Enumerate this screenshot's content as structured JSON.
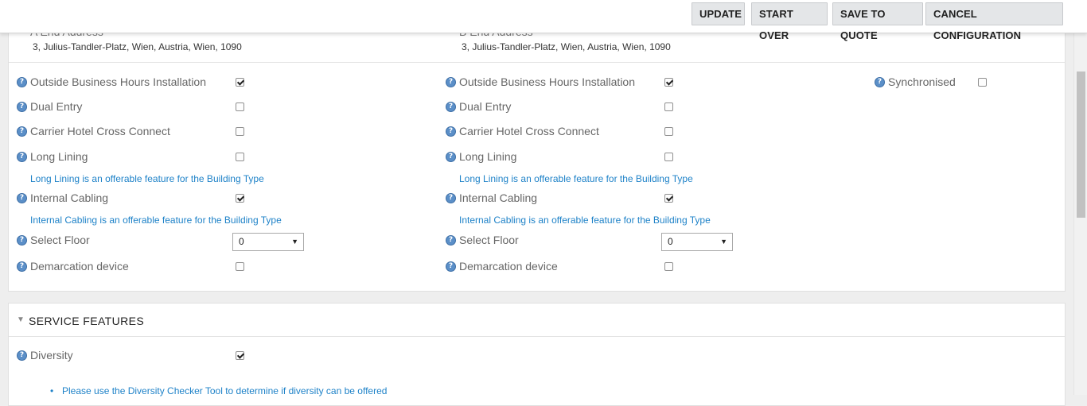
{
  "toolbar": {
    "update": "UPDATE",
    "start_over": "START OVER",
    "save_to_quote": "SAVE TO QUOTE",
    "cancel_configuration": "CANCEL CONFIGURATION"
  },
  "address": {
    "a_label": "A End Address",
    "a_value": "3, Julius-Tandler-Platz, Wien, Austria, Wien, 1090",
    "b_label": "B End Address",
    "b_value": "3, Julius-Tandler-Platz, Wien, Austria, Wien, 1090"
  },
  "features": {
    "a_end": [
      {
        "label": "Outside Business Hours Installation",
        "checked": true
      },
      {
        "label": "Dual Entry",
        "checked": false
      },
      {
        "label": "Carrier Hotel Cross Connect",
        "checked": false
      },
      {
        "label": "Long Lining",
        "checked": false,
        "note": "Long Lining is an offerable feature for the Building Type"
      },
      {
        "label": "Internal Cabling",
        "checked": true,
        "note": "Internal Cabling is an offerable feature for the Building Type"
      },
      {
        "label": "Select Floor",
        "select_value": "0"
      },
      {
        "label": "Demarcation device",
        "checked": false
      }
    ],
    "b_end": [
      {
        "label": "Outside Business Hours Installation",
        "checked": true
      },
      {
        "label": "Dual Entry",
        "checked": false
      },
      {
        "label": "Carrier Hotel Cross Connect",
        "checked": false
      },
      {
        "label": "Long Lining",
        "checked": false,
        "note": "Long Lining is an offerable feature for the Building Type"
      },
      {
        "label": "Internal Cabling",
        "checked": true,
        "note": "Internal Cabling is an offerable feature for the Building Type"
      },
      {
        "label": "Select Floor",
        "select_value": "0"
      },
      {
        "label": "Demarcation device",
        "checked": false
      }
    ],
    "synchronised": {
      "label": "Synchronised",
      "checked": false
    }
  },
  "service_features": {
    "title": "SERVICE FEATURES",
    "diversity": {
      "label": "Diversity",
      "checked": true
    },
    "diversity_note": "Please use the Diversity Checker Tool to determine if diversity can be offered"
  },
  "icons": {
    "help": "help-icon",
    "collapse": "collapse-triangle-icon"
  },
  "colors": {
    "link_blue": "#1e82c8",
    "help_icon": "#5b8fc8",
    "label_gray": "#666666"
  }
}
